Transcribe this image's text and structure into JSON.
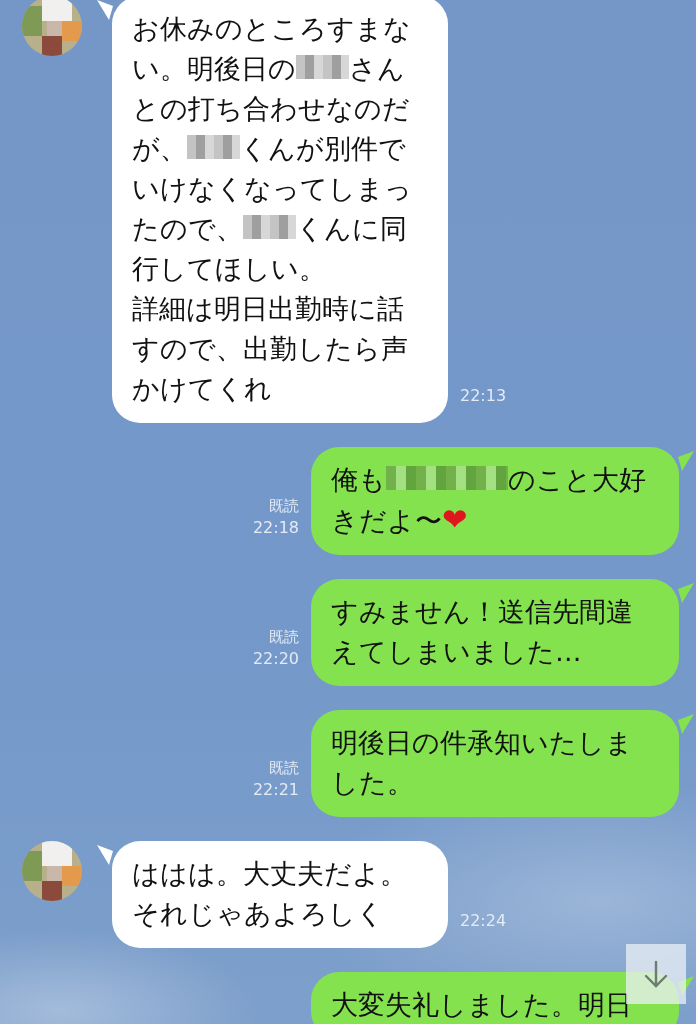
{
  "messages": [
    {
      "kind": "received",
      "avatar": true,
      "time": "22:13",
      "paragraphs": [
        [
          {
            "kind": "text",
            "text": "お休みのところすまない。明後日の"
          },
          {
            "kind": "redacted"
          },
          {
            "kind": "text",
            "text": "さんとの打ち合わせなのだが、"
          },
          {
            "kind": "redacted"
          },
          {
            "kind": "text",
            "text": "くんが別件でいけなくなってしまったので、"
          },
          {
            "kind": "redacted"
          },
          {
            "kind": "text",
            "text": "くんに同行してほしい。"
          }
        ],
        [
          {
            "kind": "text",
            "text": "詳細は明日出勤時に話すので、出勤したら声かけてくれ"
          }
        ]
      ]
    },
    {
      "kind": "sent",
      "read_label": "既読",
      "time": "22:18",
      "paragraphs": [
        [
          {
            "kind": "text",
            "text": "俺も"
          },
          {
            "kind": "redacted"
          },
          {
            "kind": "text",
            "text": "のこと大好きだよ〜"
          },
          {
            "kind": "emoji",
            "text": "❤"
          }
        ]
      ]
    },
    {
      "kind": "sent",
      "read_label": "既読",
      "time": "22:20",
      "paragraphs": [
        [
          {
            "kind": "text",
            "text": "すみません！送信先間違えてしまいました…"
          }
        ]
      ]
    },
    {
      "kind": "sent",
      "read_label": "既読",
      "time": "22:21",
      "paragraphs": [
        [
          {
            "kind": "text",
            "text": "明後日の件承知いたしました。"
          }
        ]
      ]
    },
    {
      "kind": "received",
      "avatar": true,
      "time": "22:24",
      "paragraphs": [
        [
          {
            "kind": "text",
            "text": "ははは。大丈夫だよ。"
          }
        ],
        [
          {
            "kind": "text",
            "text": "それじゃあよろしく"
          }
        ]
      ]
    },
    {
      "kind": "sent",
      "paragraphs": [
        [
          {
            "kind": "text",
            "text": "大変失礼しました。明日"
          }
        ]
      ]
    }
  ]
}
